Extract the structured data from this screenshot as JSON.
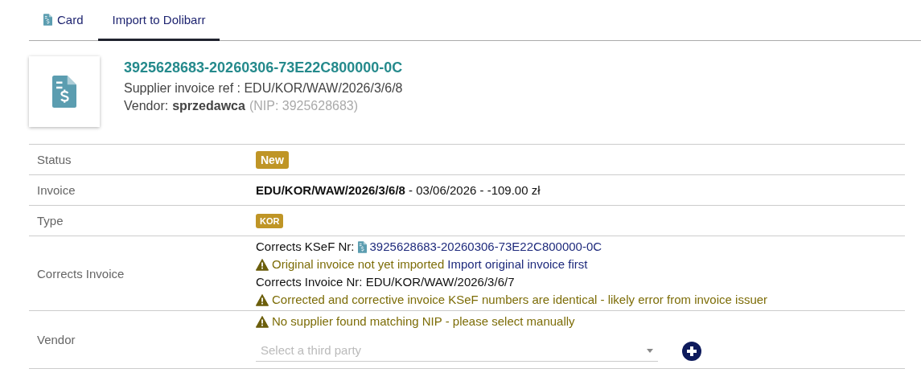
{
  "tabs": [
    {
      "label": "Card",
      "kind": "with-icon",
      "selected": false
    },
    {
      "label": "Import to Dolibarr",
      "kind": "plain",
      "selected": true
    }
  ],
  "header": {
    "title": "3925628683-20260306-73E22C800000-0C",
    "ref": "Supplier invoice ref : EDU/KOR/WAW/2026/3/6/8",
    "vendor_label": "Vendor:",
    "vendor_name": "sprzedawca",
    "vendor_nip": "(NIP: 3925628683)"
  },
  "rows": [
    {
      "label": "Status",
      "kind": "badge",
      "badge": "New",
      "small": false
    },
    {
      "label": "Invoice",
      "kind": "text",
      "text": "**EDU/KOR/WAW/2026/3/6/8** - 03/06/2026 - -109.00 zł"
    },
    {
      "label": "Type",
      "kind": "badge",
      "badge": "KOR",
      "small": true
    },
    {
      "label": "Corrects Invoice",
      "kind": "lines",
      "lines": [
        {
          "kind": "link",
          "text": "Corrects KSeF Nr:",
          "link": "3925628683-20260306-73E22C800000-0C"
        },
        {
          "kind": "warning",
          "text": "Original invoice not yet imported",
          "link": "Import original invoice first"
        },
        {
          "kind": "text",
          "text": "Corrects Invoice Nr: EDU/KOR/WAW/2026/3/6/7"
        },
        {
          "kind": "warning",
          "text": "Corrected and corrective invoice KSeF numbers are identical - likely error from invoice issuer"
        }
      ]
    },
    {
      "label": "Vendor",
      "kind": "lines",
      "lines": [
        {
          "kind": "warning",
          "text": "No supplier found matching NIP - please select manually"
        },
        {
          "kind": "select",
          "placeholder": "Select a third party"
        }
      ]
    }
  ]
}
